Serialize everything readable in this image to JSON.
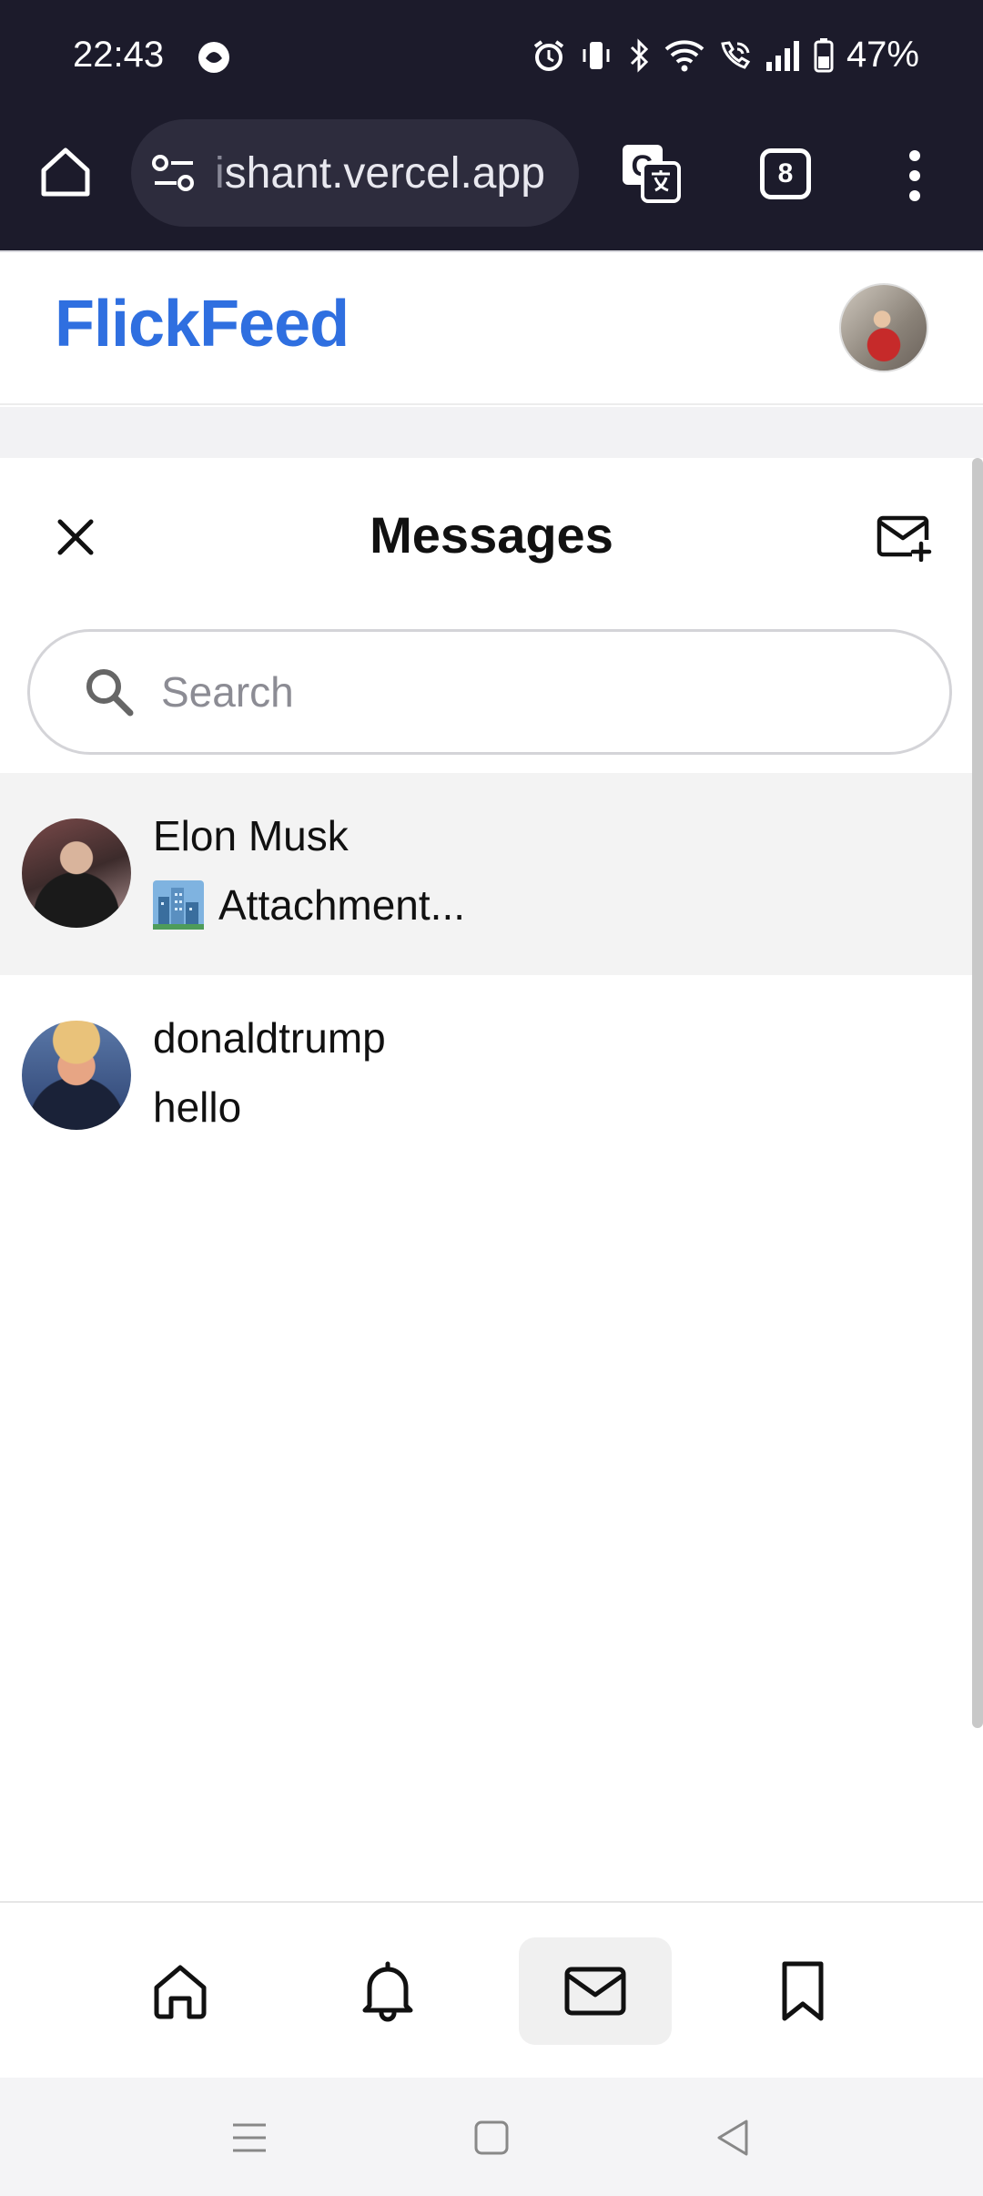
{
  "status_bar": {
    "time": "22:43",
    "battery": "47%",
    "icons": [
      "vpn-icon",
      "alarm-icon",
      "vibrate-icon",
      "bluetooth-icon",
      "wifi-icon",
      "wifi-call-icon",
      "signal-icon",
      "battery-icon"
    ]
  },
  "browser": {
    "url_faded": "i",
    "url": "shant.vercel.app",
    "tab_count": "8"
  },
  "app": {
    "brand": "FlickFeed",
    "brand_color": "#2f6fe0"
  },
  "messages": {
    "title": "Messages",
    "search_placeholder": "Search",
    "conversations": [
      {
        "name": "Elon Musk",
        "preview": "Attachment...",
        "preview_icon": "cityscape-emoji",
        "active": true
      },
      {
        "name": "donaldtrump",
        "preview": "hello",
        "active": false
      }
    ]
  },
  "bottom_nav": {
    "items": [
      "home",
      "notifications",
      "messages",
      "bookmarks"
    ],
    "active": "messages"
  }
}
